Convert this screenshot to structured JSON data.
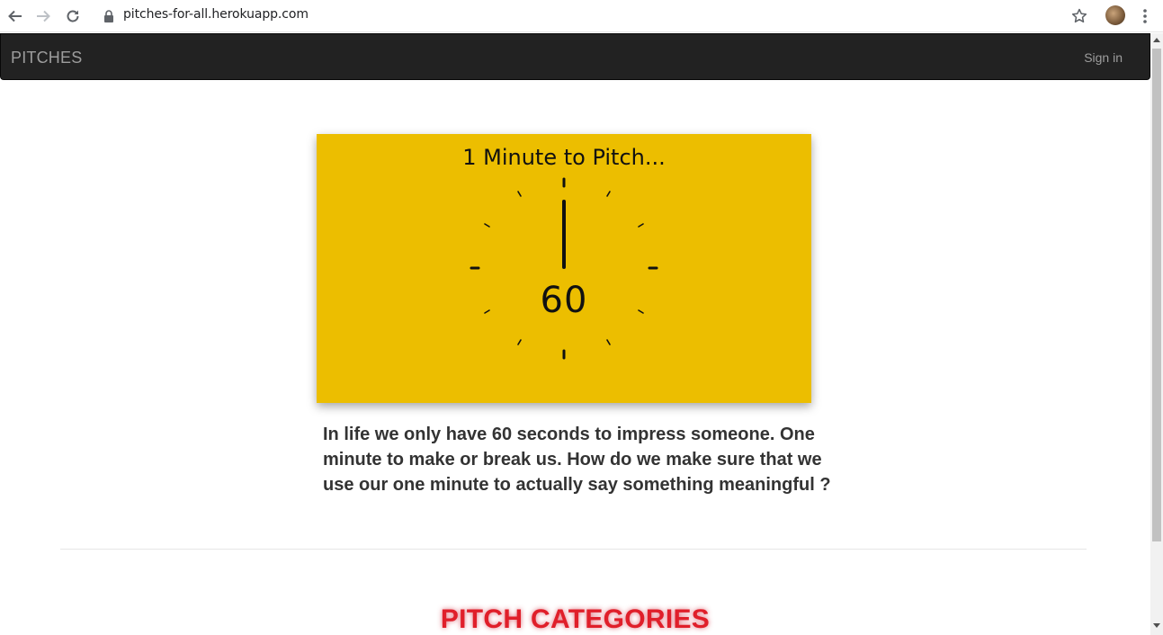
{
  "browser": {
    "url": "pitches-for-all.herokuapp.com"
  },
  "navbar": {
    "brand": "PITCHES",
    "signin_label": "Sign in"
  },
  "hero": {
    "title": "1 Minute to Pitch...",
    "countdown": "60",
    "background_color": "#ecbe00"
  },
  "intro": {
    "text": "In life we only have 60 seconds to impress someone. One minute to make or break us. How do we make sure that we use our one minute to actually say something meaningful ?"
  },
  "categories": {
    "heading": "PITCH CATEGORIES",
    "heading_color": "#e01f2a"
  },
  "icons": {
    "back": "back-arrow-icon",
    "forward": "forward-arrow-icon",
    "reload": "reload-icon",
    "lock": "lock-icon",
    "bookmark": "star-icon",
    "profile": "avatar",
    "menu": "kebab-menu-icon"
  }
}
